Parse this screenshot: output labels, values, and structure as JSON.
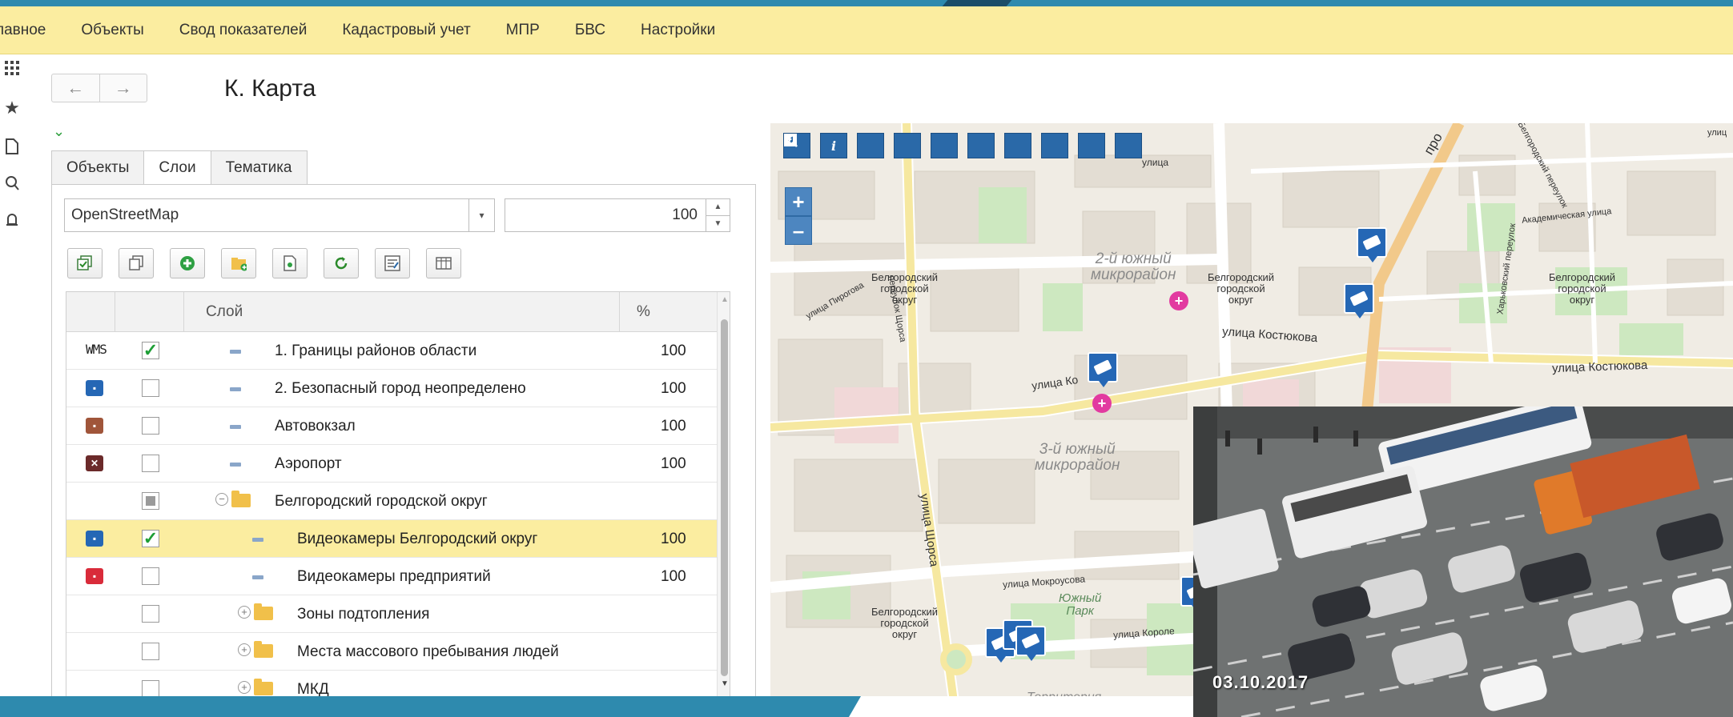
{
  "menubar": {
    "items": [
      "лавное",
      "Объекты",
      "Свод показателей",
      "Кадастровый учет",
      "МПР",
      "БВС",
      "Настройки"
    ]
  },
  "left_strip_icons": [
    "apps-grid-icon",
    "star-icon",
    "document-icon",
    "search-icon",
    "bell-icon"
  ],
  "nav": {
    "back_icon": "←",
    "forward_icon": "→"
  },
  "page": {
    "title": "К. Карта",
    "collapse_icon": "⌄"
  },
  "tabs": [
    "Объекты",
    "Слои",
    "Тематика"
  ],
  "active_tab": "Слои",
  "basemap": {
    "value": "OpenStreetMap",
    "dropdown_arrow": "▾"
  },
  "opacity": {
    "value": "100"
  },
  "toolbar_icons": [
    "check-all-icon",
    "copy-icon",
    "add-icon",
    "add-folder-icon",
    "save-icon",
    "refresh-icon",
    "settings-icon",
    "columns-icon"
  ],
  "grid": {
    "columns": {
      "layer": "Слой",
      "percent": "%"
    },
    "rows": [
      {
        "icon": "wms",
        "icon_text": "WMS",
        "checked": true,
        "level": 0,
        "kind": "dash",
        "name": "1. Границы районов области",
        "percent": "100"
      },
      {
        "icon": "blue-pin",
        "checked": false,
        "level": 0,
        "kind": "dash",
        "name": "2. Безопасный город неопределено",
        "percent": "100"
      },
      {
        "icon": "bus-station",
        "checked": false,
        "level": 0,
        "kind": "dash",
        "name": "Автовокзал",
        "percent": "100"
      },
      {
        "icon": "airport",
        "checked": false,
        "level": 0,
        "kind": "dash",
        "name": "Аэропорт",
        "percent": "100"
      },
      {
        "icon": "",
        "checked": "partial",
        "level": 0,
        "kind": "folder-open",
        "name": "Белгородский городской округ",
        "percent": ""
      },
      {
        "icon": "camera-blue",
        "checked": true,
        "level": 1,
        "kind": "dash",
        "name": "Видеокамеры Белгородский округ",
        "percent": "100",
        "selected": true
      },
      {
        "icon": "camera-red",
        "checked": false,
        "level": 1,
        "kind": "dash",
        "name": "Видеокамеры предприятий",
        "percent": "100"
      },
      {
        "icon": "",
        "checked": false,
        "level": 1,
        "kind": "folder-closed",
        "name": "Зоны подтопления",
        "percent": ""
      },
      {
        "icon": "",
        "checked": false,
        "level": 1,
        "kind": "folder-closed",
        "name": "Места массового пребывания людей",
        "percent": ""
      },
      {
        "icon": "",
        "checked": false,
        "level": 1,
        "kind": "folder-closed",
        "name": "МКД",
        "percent": ""
      }
    ]
  },
  "map": {
    "tools": [
      "home-icon",
      "info-icon",
      "pan-icon",
      "measure-line-icon",
      "measure-area-icon",
      "measure-area-2-icon",
      "filter-icon",
      "back-icon",
      "zoom-in-tool-icon",
      "zoom-out-tool-icon"
    ],
    "info_glyph": "i",
    "zoom_in": "+",
    "zoom_out": "–",
    "labels": {
      "okrug": "Белгородский городской округ",
      "okrug_line1": "Белгородский",
      "okrug_line2": "городской",
      "okrug_line3": "округ",
      "district2_line1": "2-й южный",
      "district2_line2": "микрорайон",
      "district3_line1": "3-й южный",
      "district3_line2": "микрорайон",
      "park_line1": "Южный",
      "park_line2": "Парк",
      "territory": "Территория"
    },
    "streets": {
      "kostyukova": "улица Костюкова",
      "kostyukova_short": "улица Ко",
      "shorsa": "улица Щорса",
      "mokrousova": "улица Мокроусова",
      "korolev": "улица Короле",
      "pirogova": "улица Пирогова",
      "pereulok_shorsa": "переулок Щорса",
      "akademicheskaya": "Академическая улица",
      "kharkovsky": "Харьковский переулок",
      "belgorodsky_per": "Белгородский переулок",
      "pro": "про",
      "ulits": "улиц",
      "ulitsa": "улица"
    },
    "camera_markers": 7,
    "hospital_markers": 2
  },
  "photo": {
    "date": "03.10.2017"
  },
  "colors": {
    "menubar_bg": "#fbeda0",
    "selected_row_bg": "#fbeda0",
    "map_tool_bg": "#2a69a8",
    "camera_marker": "#2567b5",
    "check_green": "#1e9e36",
    "slide_bg": "#2e8aae"
  }
}
